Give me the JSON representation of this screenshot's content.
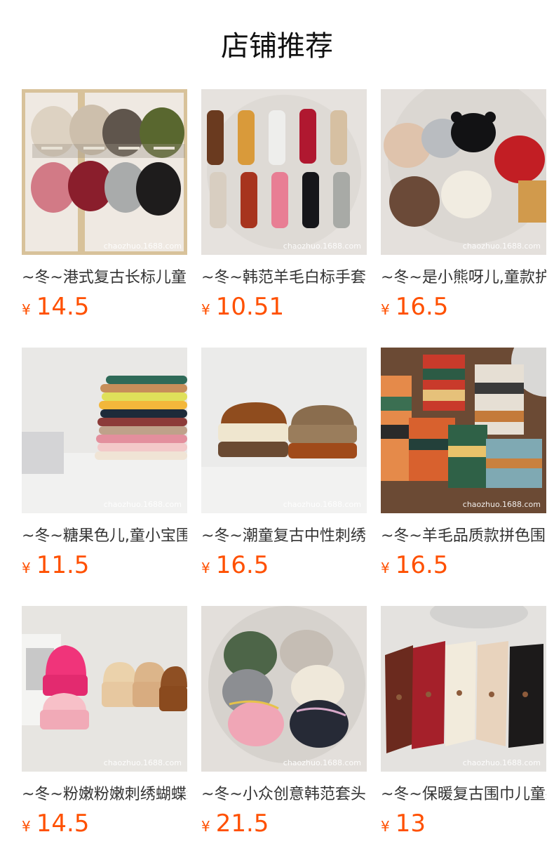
{
  "page": {
    "title": "店铺推荐"
  },
  "watermark": "chaozhuo.1688.com",
  "currency": "¥",
  "colors": {
    "price": "#ff5000",
    "title": "#111111",
    "name": "#333333"
  },
  "products": [
    {
      "name": "~冬~港式复古长标儿童毛线帽",
      "price": "14.5",
      "image": "beanies-eight-colors"
    },
    {
      "name": "~冬~韩范羊毛白标手套",
      "price": "10.51",
      "image": "knit-gloves-ten-colors"
    },
    {
      "name": "~冬~是小熊呀儿,童款护耳帽",
      "price": "16.5",
      "image": "bear-ear-hats"
    },
    {
      "name": "~冬~糖果色儿,童小宝围巾",
      "price": "11.5",
      "image": "stacked-candy-scarves"
    },
    {
      "name": "~冬~潮童复古中性刺绣帽",
      "price": "16.5",
      "image": "colorado-caps"
    },
    {
      "name": "~冬~羊毛品质款拼色围巾",
      "price": "16.5",
      "image": "striped-wool-scarves"
    },
    {
      "name": "~冬~粉嫩粉嫩刺绣蝴蝶结帽",
      "price": "14.5",
      "image": "pink-bow-beanies"
    },
    {
      "name": "~冬~小众创意韩范套头帽",
      "price": "21.5",
      "image": "line-pattern-beanies"
    },
    {
      "name": "~冬~保暖复古围巾儿童款",
      "price": "13",
      "image": "button-scarves"
    }
  ]
}
